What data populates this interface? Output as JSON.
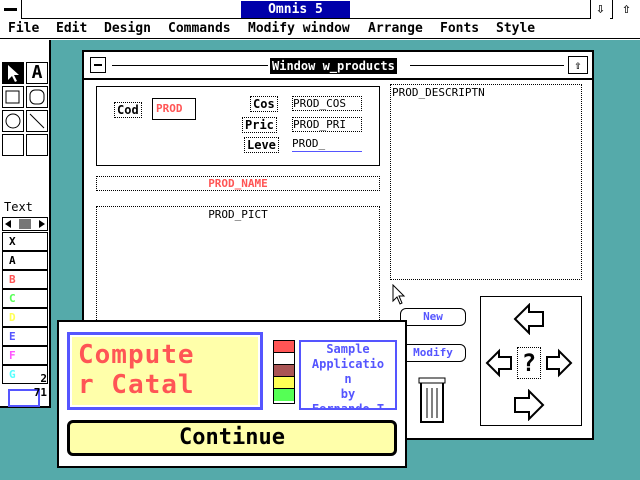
{
  "app": {
    "title": "Omnis 5",
    "scroll_up": "⇧",
    "scroll_down": "⇩"
  },
  "menu": [
    "File",
    "Edit",
    "Design",
    "Commands",
    "Modify window",
    "Arrange",
    "Fonts",
    "Style"
  ],
  "palette": {
    "tool_text": "A",
    "label": "Text",
    "colors": [
      {
        "label": "X",
        "color": "#000000"
      },
      {
        "label": "A",
        "color": "#000000"
      },
      {
        "label": "B",
        "color": "#ff5555"
      },
      {
        "label": "C",
        "color": "#55ff55"
      },
      {
        "label": "D",
        "color": "#ffff55"
      },
      {
        "label": "E",
        "color": "#5555ff"
      },
      {
        "label": "F",
        "color": "#ff55ff"
      },
      {
        "label": "G",
        "color": "#55ffff"
      }
    ],
    "count1": "2",
    "count2": "71"
  },
  "window": {
    "title": "Window w_products",
    "fields": {
      "cod_label": "Cod",
      "cod_value": "PROD",
      "cos_label": "Cos",
      "cos_value": "PROD_COS",
      "pric_label": "Pric",
      "pric_value": "PROD_PRI",
      "leve_label": "Leve",
      "leve_value": "PROD_",
      "name": "PROD_NAME",
      "pict": "PROD_PICT",
      "descr": "PROD_DESCRIPTN"
    },
    "buttons": {
      "new": "New",
      "modify": "Modify"
    },
    "nav": {
      "question": "?"
    }
  },
  "splash": {
    "name_line1": "Compute",
    "name_line2": "r Catal",
    "about": [
      "Sample",
      "Applicatio",
      "n",
      "by",
      "Fernando T"
    ],
    "continue": "Continue",
    "stripe_colors": [
      "#ff5555",
      "#ffffff",
      "#aa5555",
      "#ffff55",
      "#55ff55"
    ]
  }
}
